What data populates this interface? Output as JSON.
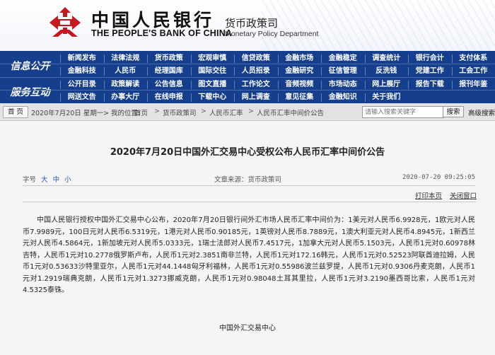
{
  "header": {
    "bank_name_cn": "中国人民银行",
    "bank_name_en": "THE PEOPLE'S BANK OF CHINA",
    "dept_cn": "货币政策司",
    "dept_en": "Monetary Policy Department",
    "emblem_color": "#c8161d"
  },
  "nav": {
    "background": "#153f8c",
    "sections": [
      {
        "title": "信息公开",
        "rows": [
          [
            "新闻发布",
            "法律法规",
            "货币政策",
            "宏观审慎",
            "信贷政策",
            "金融市场",
            "金融稳定",
            "调查统计",
            "银行会计",
            "支付体系"
          ],
          [
            "金融科技",
            "人民币",
            "经理国库",
            "国际交往",
            "人员招录",
            "金融研究",
            "征信管理",
            "反洗钱",
            "党建工作",
            "工会工作"
          ]
        ]
      },
      {
        "title": "服务互动",
        "rows": [
          [
            "公开目录",
            "政策解读",
            "公告信息",
            "图文直播",
            "工作论文",
            "音频视频",
            "市场动态",
            "网上展厅",
            "报告下载",
            "报刊年鉴"
          ],
          [
            "网送文告",
            "办事大厅",
            "在线申报",
            "下载中心",
            "网上调查",
            "意见征集",
            "金融知识",
            "关于我们"
          ]
        ]
      }
    ]
  },
  "breadcrumb": {
    "home_label": "首 页",
    "date": "2020年7月20日 星期一",
    "location_label": "我的位置:",
    "items": [
      "首页",
      "货币政策司",
      "人民币汇率",
      "人民币汇率中间价公告"
    ],
    "separator": ">",
    "search_placeholder": "请输入搜索关键字",
    "search_button": "搜索",
    "advanced_search": "高级搜索"
  },
  "article": {
    "title": "2020年7月20日中国外汇交易中心受权公布人民币汇率中间价公告",
    "font_size_label": "字号",
    "font_sizes": [
      "大",
      "中",
      "小"
    ],
    "source": "文章来源：货币政策司",
    "datetime": "2020-07-20 09:25:05",
    "print_label": "打印本页",
    "close_label": "关闭窗口",
    "body": "中国人民银行授权中国外汇交易中心公布，2020年7月20日银行间外汇市场人民币汇率中间价为：1美元对人民币6.9928元，1欧元对人民币7.9989元，100日元对人民币6.5319元，1港元对人民币0.90185元，1英镑对人民币8.7889元，1澳大利亚元对人民币4.8945元，1新西兰元对人民币4.5864元，1新加坡元对人民币5.0333元，1瑞士法郎对人民币7.4517元，1加拿大元对人民币5.1503元，人民币1元对0.60978林吉特，人民币1元对10.2778俄罗斯卢布，人民币1元对2.3851南非兰特，人民币1元对172.16韩元，人民币1元对0.52523阿联酋迪拉姆，人民币1元对0.53633沙特里亚尔，人民币1元对44.1448匈牙利福林，人民币1元对0.55986波兰兹罗提，人民币1元对0.9306丹麦克朗，人民币1元对1.2919瑞典克朗，人民币1元对1.3273挪威克朗，人民币1元对0.98048土耳其里拉，人民币1元对3.2190墨西哥比索，人民币1元对4.5325泰铢。",
    "signature": "中国外汇交易中心"
  }
}
